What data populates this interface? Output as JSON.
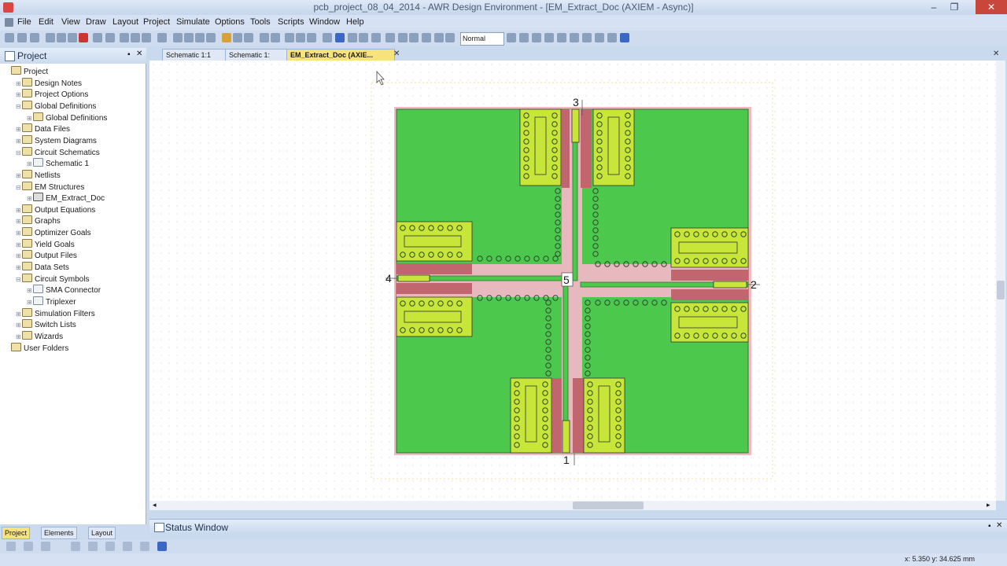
{
  "window": {
    "title": "pcb_project_08_04_2014 - AWR Design Environment - [EM_Extract_Doc (AXIEM - Async)]",
    "minimize": "–",
    "maximize": "❐",
    "close": "✕"
  },
  "menu": [
    "File",
    "Edit",
    "View",
    "Draw",
    "Layout",
    "Project",
    "Simulate",
    "Options",
    "Tools",
    "Scripts",
    "Window",
    "Help"
  ],
  "toolbar": {
    "zoom_mode": "Normal"
  },
  "project_panel": {
    "title": "Project",
    "tree": [
      {
        "label": "Project",
        "depth": 0,
        "icon": "project-icon"
      },
      {
        "label": "Design Notes",
        "depth": 1,
        "icon": "folder-icon"
      },
      {
        "label": "Project Options",
        "depth": 1,
        "icon": "folder-icon"
      },
      {
        "label": "Global Definitions",
        "depth": 1,
        "icon": "folder-icon",
        "expanded": true
      },
      {
        "label": "Global Definitions",
        "depth": 2,
        "icon": "folder-icon"
      },
      {
        "label": "Data Files",
        "depth": 1,
        "icon": "folder-icon"
      },
      {
        "label": "System Diagrams",
        "depth": 1,
        "icon": "folder-icon"
      },
      {
        "label": "Circuit Schematics",
        "depth": 1,
        "icon": "folder-icon",
        "expanded": true
      },
      {
        "label": "Schematic 1",
        "depth": 2,
        "icon": "schematic-icon"
      },
      {
        "label": "Netlists",
        "depth": 1,
        "icon": "folder-icon"
      },
      {
        "label": "EM Structures",
        "depth": 1,
        "icon": "folder-icon",
        "expanded": true
      },
      {
        "label": "EM_Extract_Doc",
        "depth": 2,
        "icon": "em-structure-icon"
      },
      {
        "label": "Output Equations",
        "depth": 1,
        "icon": "folder-icon"
      },
      {
        "label": "Graphs",
        "depth": 1,
        "icon": "folder-icon"
      },
      {
        "label": "Optimizer Goals",
        "depth": 1,
        "icon": "folder-icon"
      },
      {
        "label": "Yield Goals",
        "depth": 1,
        "icon": "folder-icon"
      },
      {
        "label": "Output Files",
        "depth": 1,
        "icon": "folder-icon"
      },
      {
        "label": "Data Sets",
        "depth": 1,
        "icon": "folder-icon"
      },
      {
        "label": "Circuit Symbols",
        "depth": 1,
        "icon": "folder-icon",
        "expanded": true
      },
      {
        "label": "SMA Connector",
        "depth": 2,
        "icon": "schematic-icon"
      },
      {
        "label": "Triplexer",
        "depth": 2,
        "icon": "schematic-icon"
      },
      {
        "label": "Simulation Filters",
        "depth": 1,
        "icon": "folder-icon"
      },
      {
        "label": "Switch Lists",
        "depth": 1,
        "icon": "folder-icon"
      },
      {
        "label": "Wizards",
        "depth": 1,
        "icon": "wizard-icon"
      },
      {
        "label": "User Folders",
        "depth": 0,
        "icon": "folder-icon"
      }
    ]
  },
  "tabs": [
    {
      "label": "Schematic 1:1",
      "active": false
    },
    {
      "label": "Schematic 1:",
      "active": false
    },
    {
      "label": "EM_Extract_Doc (AXIE...",
      "active": true
    }
  ],
  "layout": {
    "ports": [
      "1",
      "2",
      "3",
      "4",
      "5"
    ],
    "colors": {
      "board": "#4cc94c",
      "pad": "#c8e63a",
      "trace": "#e8b8bf",
      "ground": "#c1656e",
      "via": "#2d2d2d"
    }
  },
  "status_window": {
    "title": "Status Window"
  },
  "bottom_tabs": [
    {
      "label": "Project",
      "active": true
    },
    {
      "label": "Elements",
      "active": false
    },
    {
      "label": "Layout",
      "active": false
    }
  ],
  "statusbar": {
    "coords": "x:   5.350  y:   34.625  mm"
  }
}
